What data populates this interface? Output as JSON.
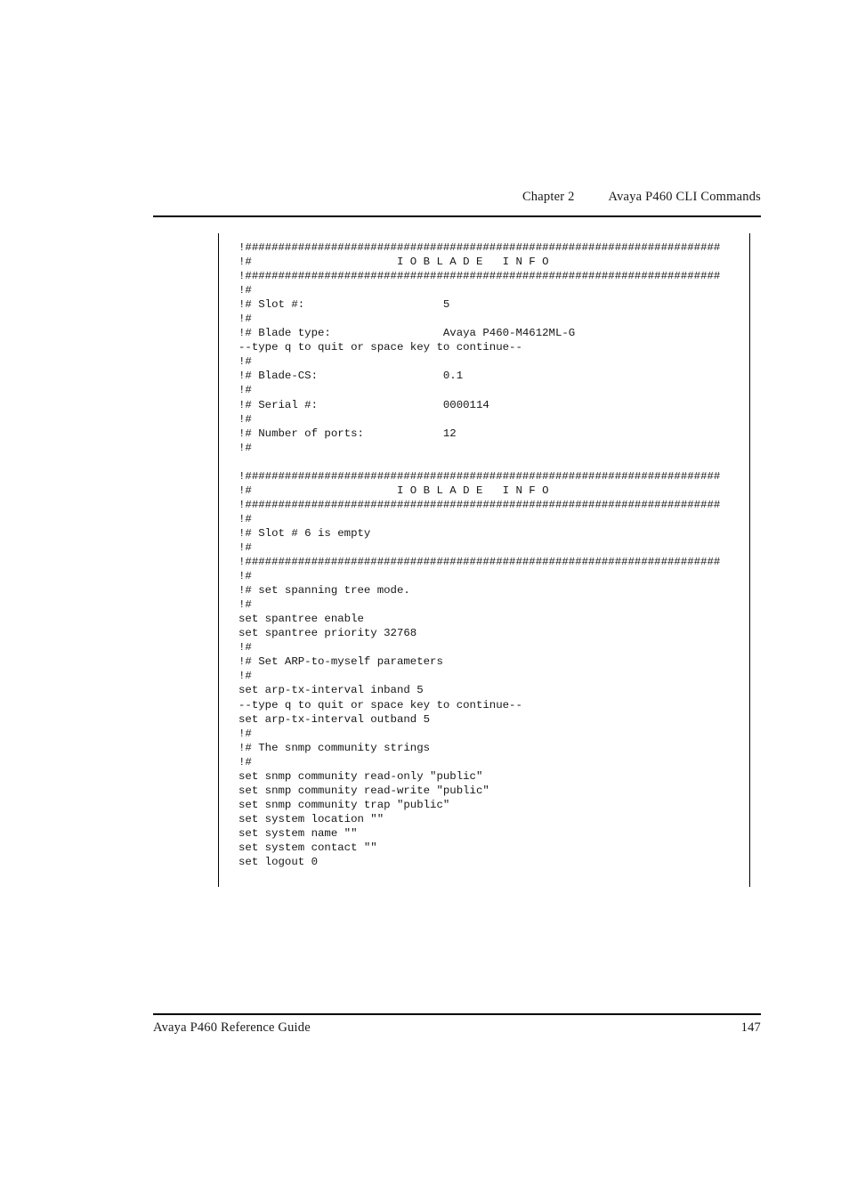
{
  "header": {
    "chapter_label": "Chapter 2",
    "chapter_title": "Avaya P460 CLI Commands"
  },
  "footer": {
    "guide_title": "Avaya P460 Reference Guide",
    "page_number": "147"
  },
  "code_block": {
    "language": "cli-output",
    "lines": [
      "!########################################################################",
      "!#                      I O B L A D E   I N F O",
      "!########################################################################",
      "!#",
      "!# Slot #:                     5",
      "!#",
      "!# Blade type:                 Avaya P460-M4612ML-G",
      "--type q to quit or space key to continue--",
      "!#",
      "!# Blade-CS:                   0.1",
      "!#",
      "!# Serial #:                   0000114",
      "!#",
      "!# Number of ports:            12",
      "!#",
      "",
      "!########################################################################",
      "!#                      I O B L A D E   I N F O",
      "!########################################################################",
      "!#",
      "!# Slot # 6 is empty",
      "!#",
      "!########################################################################",
      "!#",
      "!# set spanning tree mode.",
      "!#",
      "set spantree enable",
      "set spantree priority 32768",
      "!#",
      "!# Set ARP-to-myself parameters",
      "!#",
      "set arp-tx-interval inband 5",
      "--type q to quit or space key to continue--",
      "set arp-tx-interval outband 5",
      "!#",
      "!# The snmp community strings",
      "!#",
      "set snmp community read-only \"public\"",
      "set snmp community read-write \"public\"",
      "set snmp community trap \"public\"",
      "set system location \"\"",
      "set system name \"\"",
      "set system contact \"\"",
      "set logout 0"
    ]
  }
}
